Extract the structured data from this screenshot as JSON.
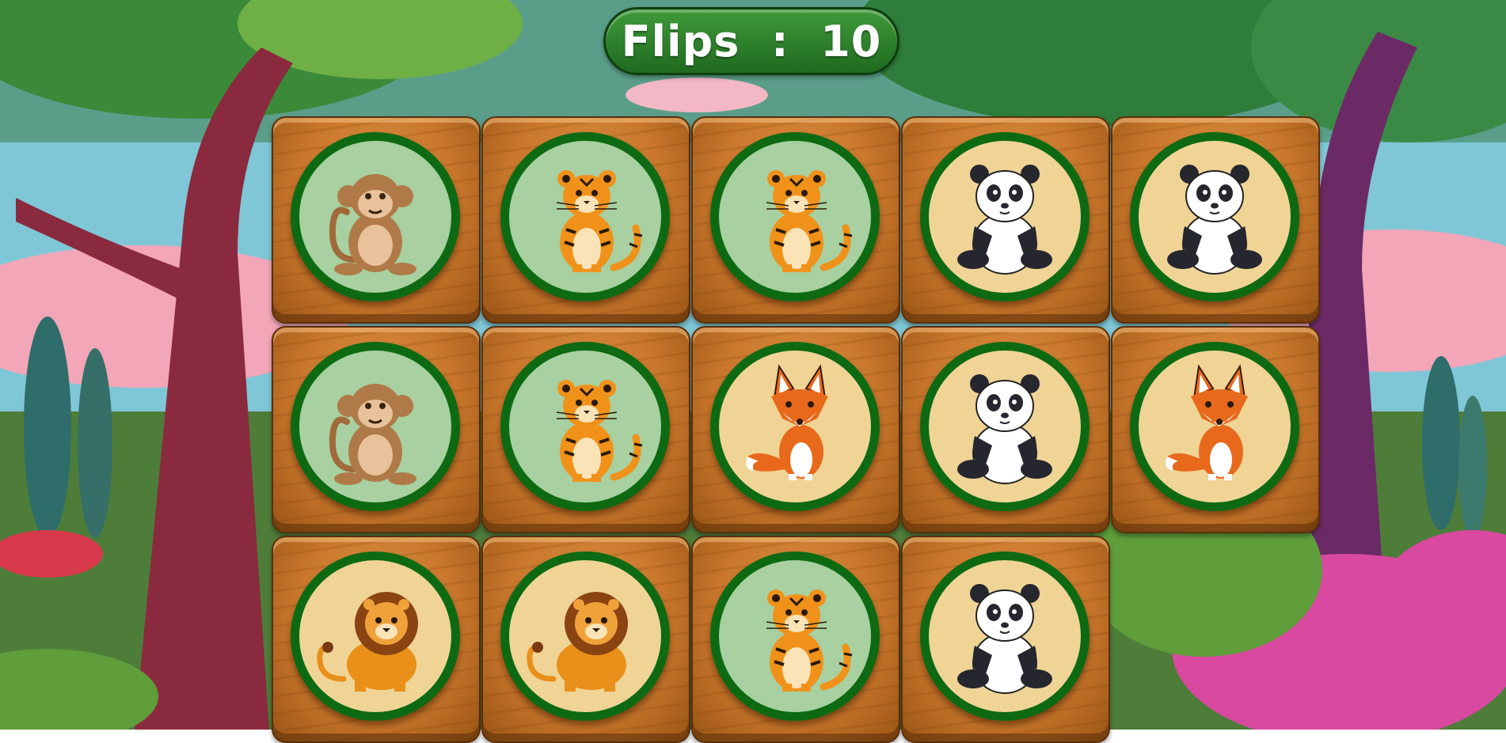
{
  "hud": {
    "flips_label": "Flips",
    "separator": ":",
    "flips_value": "10"
  },
  "colors": {
    "disc_border": "#0e6a12",
    "disc_green": "#a8d0a0",
    "disc_cream": "#f0d496",
    "wood": "#c9772c"
  },
  "board": {
    "columns": 5,
    "cards": [
      {
        "animal": "monkey",
        "disc": "green"
      },
      {
        "animal": "tiger",
        "disc": "green"
      },
      {
        "animal": "tiger",
        "disc": "green"
      },
      {
        "animal": "panda",
        "disc": "cream"
      },
      {
        "animal": "panda",
        "disc": "cream"
      },
      {
        "animal": "monkey",
        "disc": "green"
      },
      {
        "animal": "tiger",
        "disc": "green"
      },
      {
        "animal": "fox",
        "disc": "cream"
      },
      {
        "animal": "panda",
        "disc": "cream"
      },
      {
        "animal": "fox",
        "disc": "cream"
      },
      {
        "animal": "lion",
        "disc": "cream"
      },
      {
        "animal": "lion",
        "disc": "cream"
      },
      {
        "animal": "tiger",
        "disc": "green"
      },
      {
        "animal": "panda",
        "disc": "cream"
      }
    ]
  }
}
